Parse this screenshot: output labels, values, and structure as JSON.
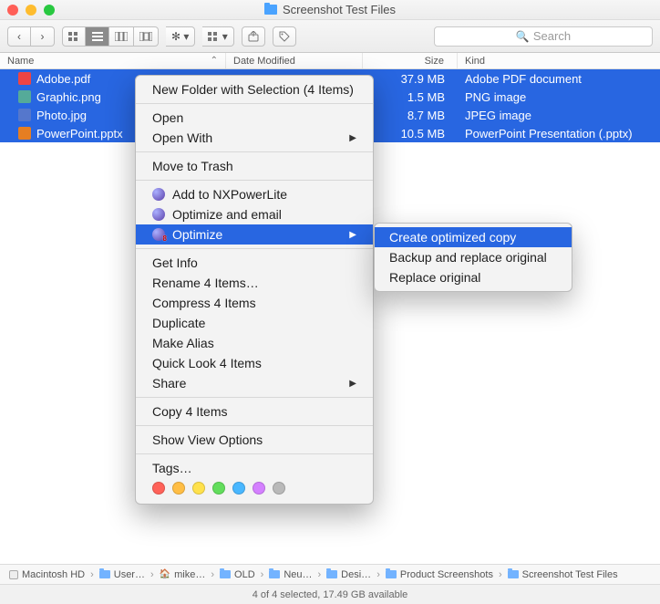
{
  "window": {
    "title": "Screenshot Test Files"
  },
  "toolbar": {
    "search_placeholder": "Search"
  },
  "columns": {
    "name": "Name",
    "date": "Date Modified",
    "size": "Size",
    "kind": "Kind"
  },
  "files": [
    {
      "name": "Adobe.pdf",
      "size": "37.9 MB",
      "kind": "Adobe PDF document",
      "icon": "fi-pdf"
    },
    {
      "name": "Graphic.png",
      "size": "1.5 MB",
      "kind": "PNG image",
      "icon": "fi-png"
    },
    {
      "name": "Photo.jpg",
      "size": "8.7 MB",
      "kind": "JPEG image",
      "icon": "fi-jpg"
    },
    {
      "name": "PowerPoint.pptx",
      "size": "10.5 MB",
      "kind": "PowerPoint Presentation (.pptx)",
      "icon": "fi-pptx"
    }
  ],
  "context_menu": {
    "new_folder": "New Folder with Selection (4 Items)",
    "open": "Open",
    "open_with": "Open With",
    "trash": "Move to Trash",
    "nx_add": "Add to NXPowerLite",
    "nx_email": "Optimize and email",
    "nx_optimize": "Optimize",
    "get_info": "Get Info",
    "rename": "Rename 4 Items…",
    "compress": "Compress 4 Items",
    "duplicate": "Duplicate",
    "alias": "Make Alias",
    "quicklook": "Quick Look 4 Items",
    "share": "Share",
    "copy": "Copy 4 Items",
    "view_options": "Show View Options",
    "tags": "Tags…",
    "tag_colors": [
      "#ff6259",
      "#ffbe45",
      "#ffe14c",
      "#62dd5c",
      "#49b7ff",
      "#d480ff",
      "#b9b9b9"
    ]
  },
  "submenu": {
    "create": "Create optimized copy",
    "backup": "Backup and replace original",
    "replace": "Replace original"
  },
  "path": [
    "Macintosh HD",
    "User…",
    "mike…",
    "OLD",
    "Neu…",
    "Desi…",
    "Product Screenshots",
    "Screenshot Test Files"
  ],
  "status": "4 of 4 selected, 17.49 GB available"
}
